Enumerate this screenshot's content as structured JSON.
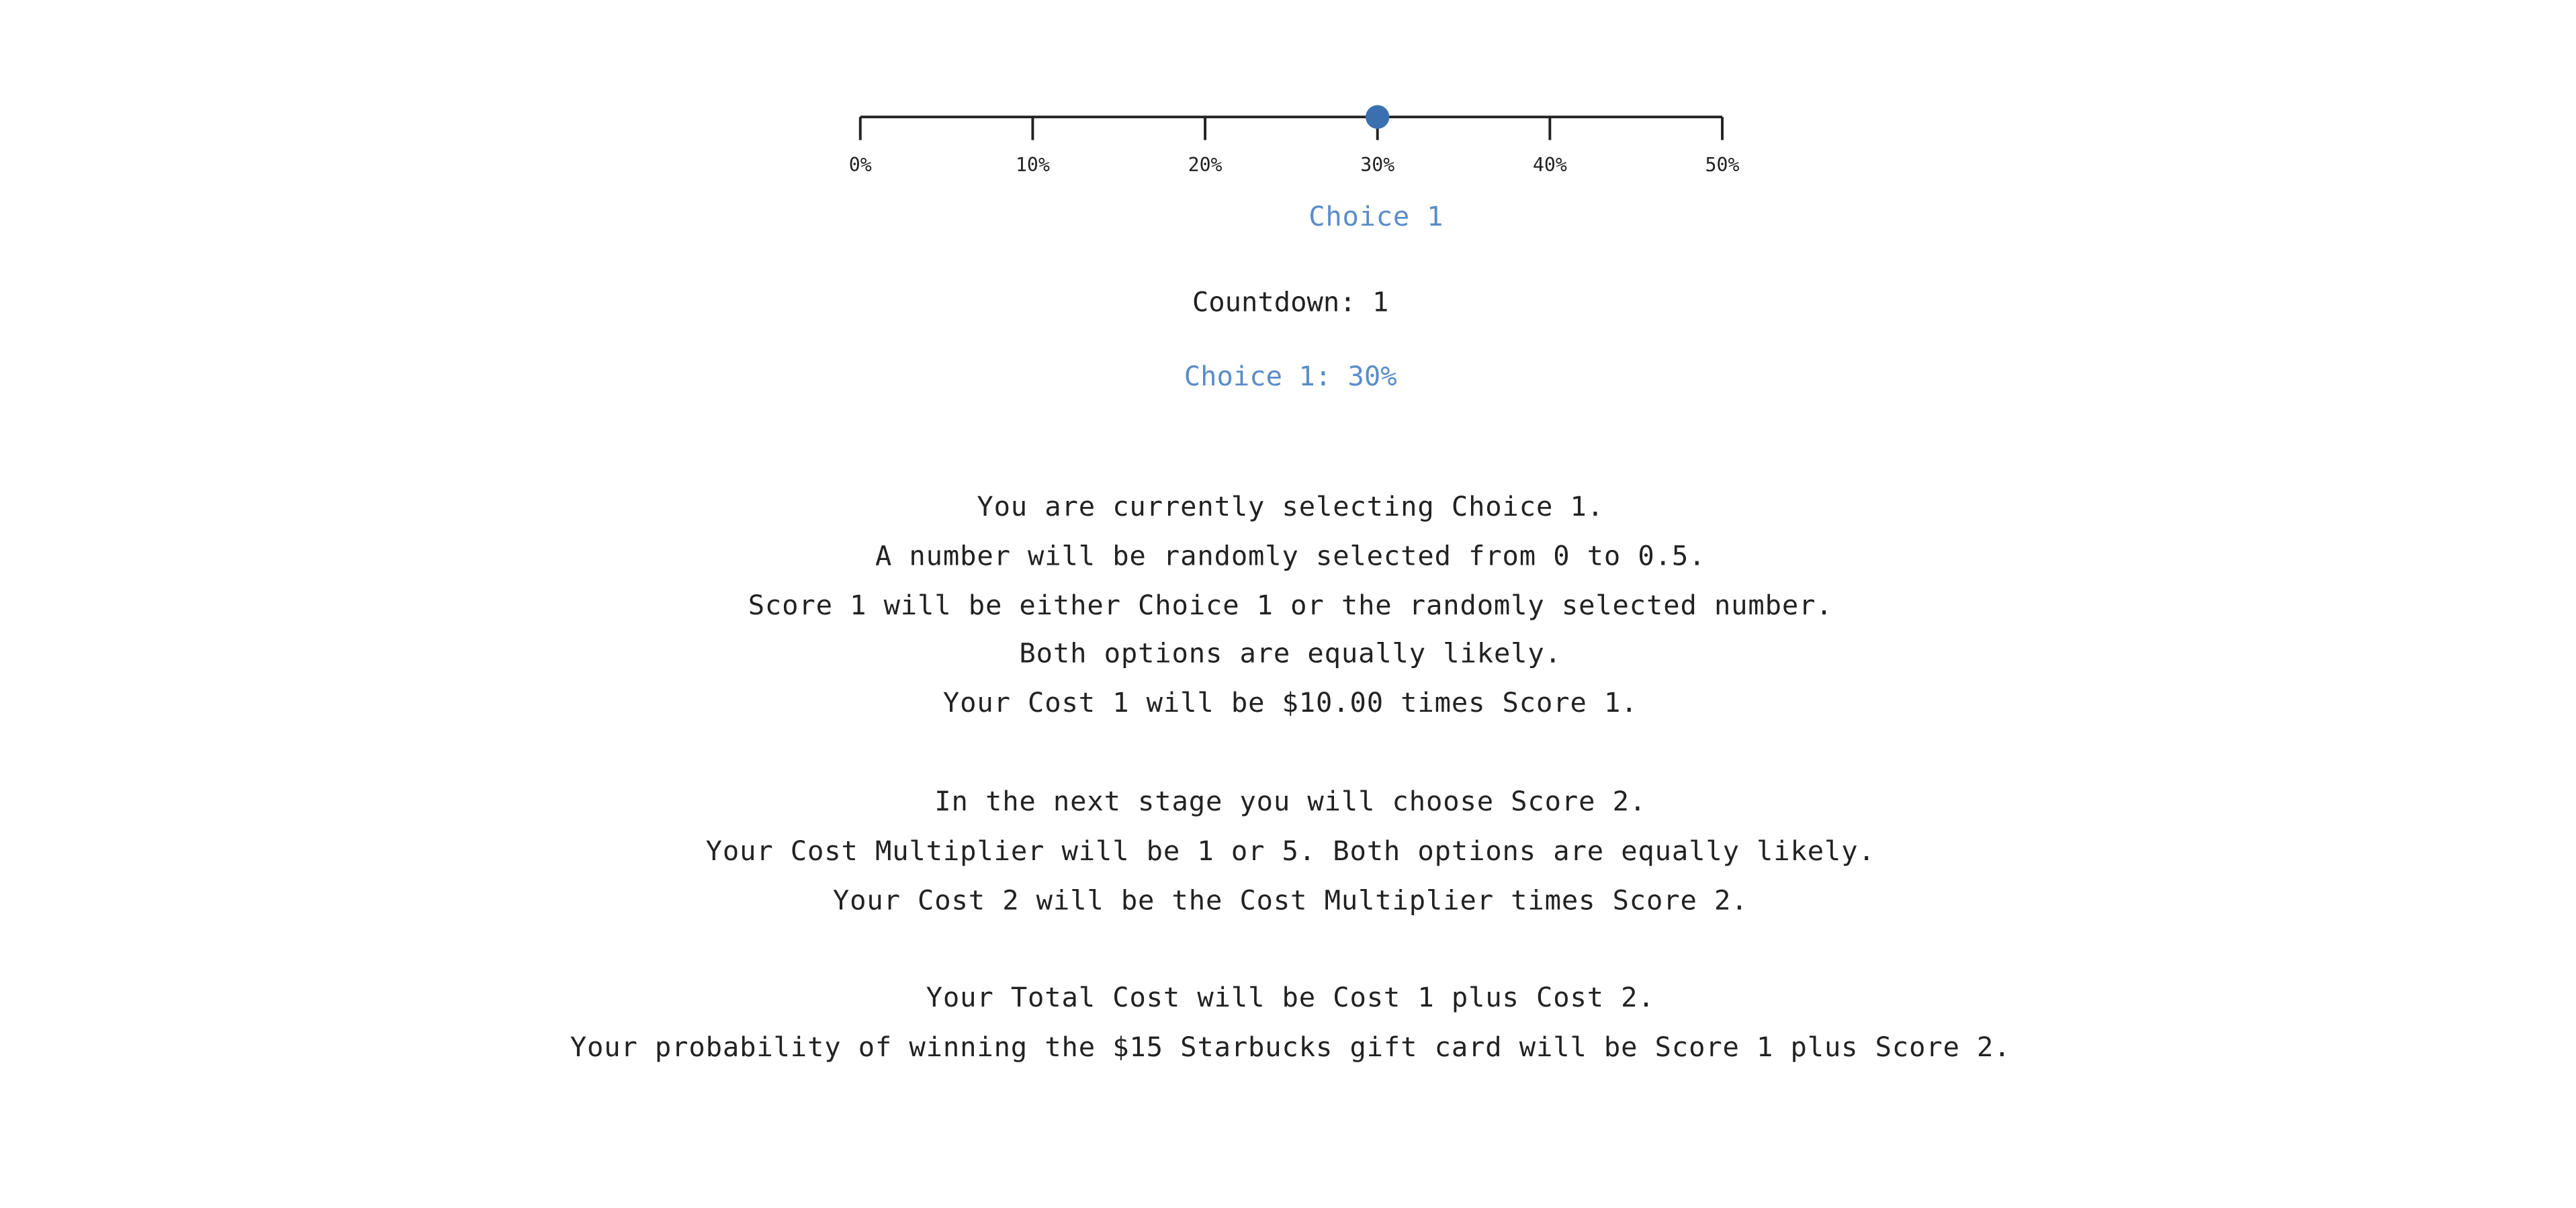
{
  "slider": {
    "ticks": [
      "0%",
      "10%",
      "20%",
      "30%",
      "40%",
      "50%"
    ],
    "min": 0,
    "max": 50,
    "value": 30,
    "handle_color": "#3a70b0",
    "label": "Choice 1"
  },
  "countdown": {
    "label": "Countdown: ",
    "value": "1"
  },
  "choice_summary": {
    "label": "Choice 1: ",
    "value": "30%"
  },
  "info": {
    "paragraph1": [
      "You are currently selecting Choice 1.",
      "A number will be randomly selected from 0 to 0.5.",
      "Score 1 will be either Choice 1 or the randomly selected number.",
      "Both options are equally likely.",
      "Your Cost 1 will be $10.00 times Score 1."
    ],
    "paragraph2": [
      "In the next stage you will choose Score 2.",
      "Your Cost Multiplier will be 1 or 5. Both options are equally likely.",
      "Your Cost 2 will be the Cost Multiplier times Score 2."
    ],
    "paragraph3": [
      "Your Total Cost will be Cost 1 plus Cost 2.",
      "Your probability of winning the $15 Starbucks gift card will be Score 1 plus Score 2."
    ]
  }
}
